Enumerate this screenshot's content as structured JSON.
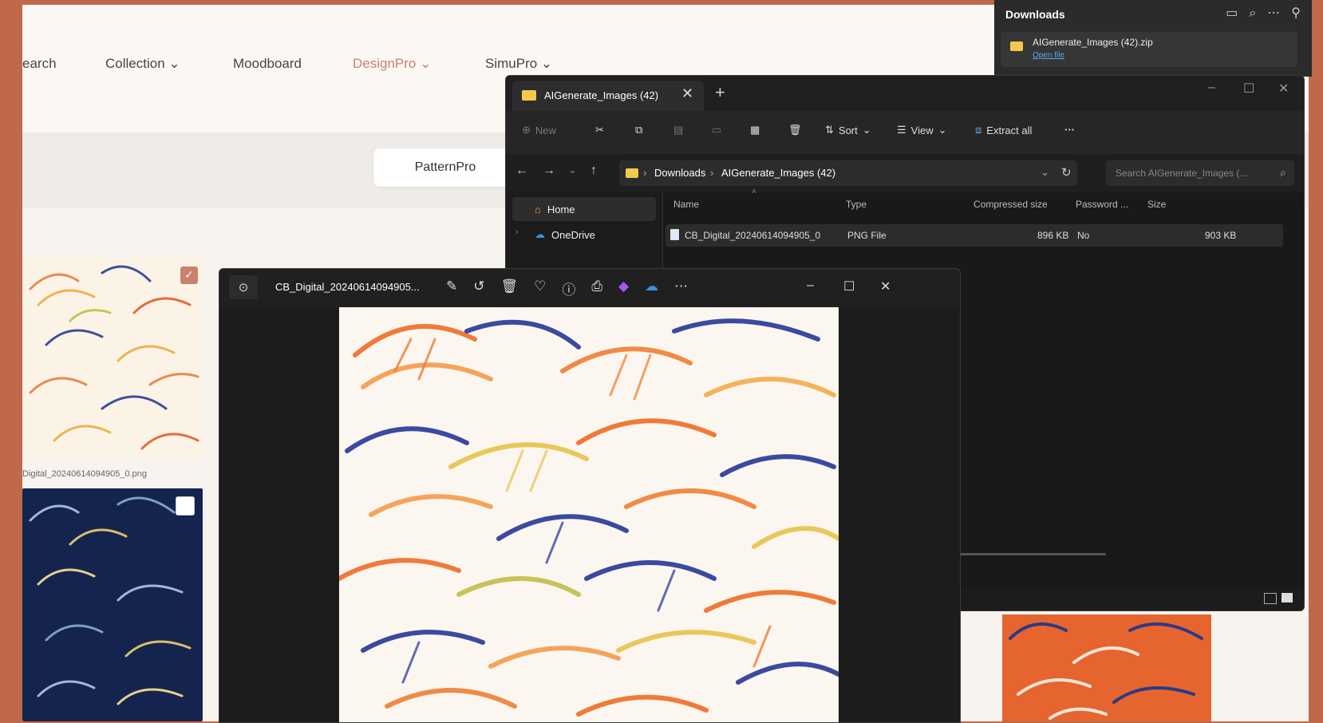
{
  "web": {
    "nav": [
      "earch",
      "Collection",
      "Moodboard",
      "DesignPro",
      "SimuPro"
    ],
    "chevron": "⌄",
    "pill_label": "PatternPro",
    "caption": "Digital_20240614094905_0.png"
  },
  "downloads": {
    "title": "Downloads",
    "file_name": "AIGenerate_Images (42).zip",
    "open_link": "Open file"
  },
  "explorer": {
    "tab_title": "AIGenerate_Images (42)",
    "toolbar": {
      "new": "New",
      "sort": "Sort",
      "view": "View",
      "extract_all": "Extract all",
      "more": "···"
    },
    "path": [
      "Downloads",
      "AIGenerate_Images (42)"
    ],
    "search_placeholder": "Search AIGenerate_Images (...",
    "sidebar": [
      "Home",
      "OneDrive"
    ],
    "columns": [
      "Name",
      "Type",
      "Compressed size",
      "Password ...",
      "Size"
    ],
    "rows": [
      {
        "name": "CB_Digital_20240614094905_0",
        "type": "PNG File",
        "compressed": "896 KB",
        "password": "No",
        "size": "903 KB"
      }
    ]
  },
  "viewer": {
    "title": "CB_Digital_20240614094905..."
  },
  "colors": {
    "background": "#c0694a",
    "accent_nav": "#c9826c",
    "folder": "#f2c94c",
    "link": "#5aa7f0"
  }
}
